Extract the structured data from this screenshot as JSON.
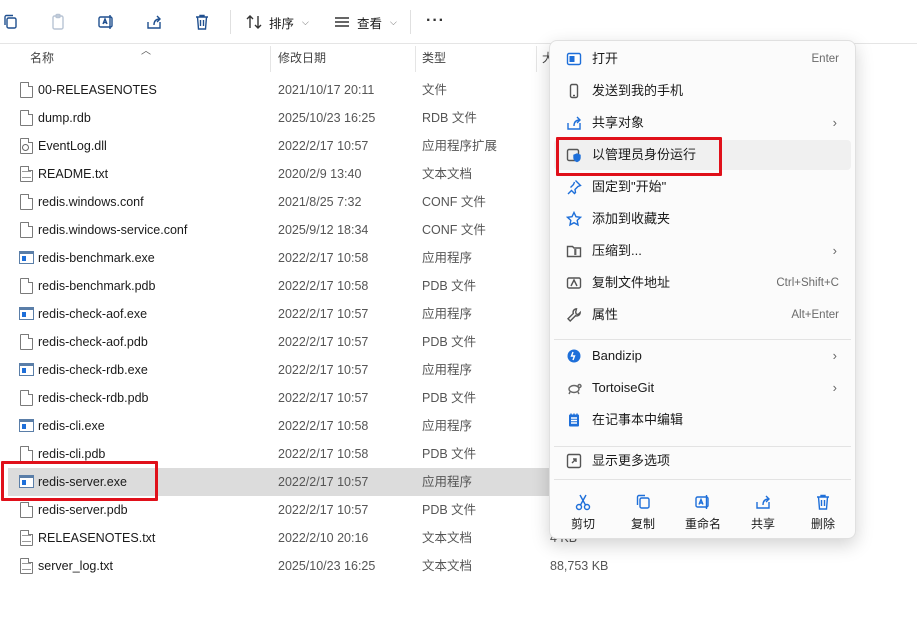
{
  "toolbar": {
    "sort_label": "排序",
    "view_label": "查看",
    "more_label": "···"
  },
  "columns": {
    "name": "名称",
    "date": "修改日期",
    "type": "类型",
    "size": "大"
  },
  "files": [
    {
      "name": "00-RELEASENOTES",
      "date": "2021/10/17 20:11",
      "type": "文件",
      "size": "",
      "icon": "file-icon"
    },
    {
      "name": "dump.rdb",
      "date": "2025/10/23 16:25",
      "type": "RDB 文件",
      "size": "",
      "icon": "file-icon"
    },
    {
      "name": "EventLog.dll",
      "date": "2022/2/17 10:57",
      "type": "应用程序扩展",
      "size": "",
      "icon": "dll-icon"
    },
    {
      "name": "README.txt",
      "date": "2020/2/9 13:40",
      "type": "文本文档",
      "size": "",
      "icon": "text-file-icon"
    },
    {
      "name": "redis.windows.conf",
      "date": "2021/8/25 7:32",
      "type": "CONF 文件",
      "size": "",
      "icon": "file-icon"
    },
    {
      "name": "redis.windows-service.conf",
      "date": "2025/9/12 18:34",
      "type": "CONF 文件",
      "size": "",
      "icon": "file-icon"
    },
    {
      "name": "redis-benchmark.exe",
      "date": "2022/2/17 10:58",
      "type": "应用程序",
      "size": "",
      "icon": "exe-icon"
    },
    {
      "name": "redis-benchmark.pdb",
      "date": "2022/2/17 10:58",
      "type": "PDB 文件",
      "size": "",
      "icon": "file-icon"
    },
    {
      "name": "redis-check-aof.exe",
      "date": "2022/2/17 10:57",
      "type": "应用程序",
      "size": "",
      "icon": "exe-icon"
    },
    {
      "name": "redis-check-aof.pdb",
      "date": "2022/2/17 10:57",
      "type": "PDB 文件",
      "size": "",
      "icon": "file-icon"
    },
    {
      "name": "redis-check-rdb.exe",
      "date": "2022/2/17 10:57",
      "type": "应用程序",
      "size": "",
      "icon": "exe-icon"
    },
    {
      "name": "redis-check-rdb.pdb",
      "date": "2022/2/17 10:57",
      "type": "PDB 文件",
      "size": "",
      "icon": "file-icon"
    },
    {
      "name": "redis-cli.exe",
      "date": "2022/2/17 10:58",
      "type": "应用程序",
      "size": "",
      "icon": "exe-icon"
    },
    {
      "name": "redis-cli.pdb",
      "date": "2022/2/17 10:58",
      "type": "PDB 文件",
      "size": "",
      "icon": "file-icon"
    },
    {
      "name": "redis-server.exe",
      "date": "2022/2/17 10:57",
      "type": "应用程序",
      "size": "",
      "icon": "exe-icon",
      "selected": true
    },
    {
      "name": "redis-server.pdb",
      "date": "2022/2/17 10:57",
      "type": "PDB 文件",
      "size": "",
      "icon": "file-icon"
    },
    {
      "name": "RELEASENOTES.txt",
      "date": "2022/2/10 20:16",
      "type": "文本文档",
      "size": "4 KB",
      "icon": "text-file-icon"
    },
    {
      "name": "server_log.txt",
      "date": "2025/10/23 16:25",
      "type": "文本文档",
      "size": "88,753 KB",
      "icon": "text-file-icon"
    }
  ],
  "context_menu": {
    "items": [
      {
        "label": "打开",
        "shortcut": "Enter",
        "icon": "open-app-icon"
      },
      {
        "label": "发送到我的手机",
        "shortcut": "",
        "icon": "phone-icon"
      },
      {
        "label": "共享对象",
        "shortcut": "",
        "icon": "share-icon",
        "submenu": true
      },
      {
        "label": "以管理员身份运行",
        "shortcut": "",
        "icon": "admin-shield-icon",
        "highlighted": true
      },
      {
        "label": "固定到\"开始\"",
        "shortcut": "",
        "icon": "pin-icon"
      },
      {
        "label": "添加到收藏夹",
        "shortcut": "",
        "icon": "star-icon"
      },
      {
        "label": "压缩到...",
        "shortcut": "",
        "icon": "zip-folder-icon",
        "submenu": true
      },
      {
        "label": "复制文件地址",
        "shortcut": "Ctrl+Shift+C",
        "icon": "copy-path-icon"
      },
      {
        "label": "属性",
        "shortcut": "Alt+Enter",
        "icon": "wrench-icon"
      },
      {
        "label": "Bandizip",
        "shortcut": "",
        "icon": "bandizip-icon",
        "submenu": true
      },
      {
        "label": "TortoiseGit",
        "shortcut": "",
        "icon": "tortoisegit-icon",
        "submenu": true
      },
      {
        "label": "在记事本中编辑",
        "shortcut": "",
        "icon": "notepad-icon"
      },
      {
        "label": "显示更多选项",
        "shortcut": "",
        "icon": "more-options-icon"
      }
    ],
    "quick_actions": [
      {
        "label": "剪切",
        "icon": "cut-icon"
      },
      {
        "label": "复制",
        "icon": "copy-icon"
      },
      {
        "label": "重命名",
        "icon": "rename-icon"
      },
      {
        "label": "共享",
        "icon": "share-icon"
      },
      {
        "label": "删除",
        "icon": "delete-icon"
      }
    ]
  },
  "colors": {
    "accent": "#1e6fd9",
    "highlight_box": "#e0101a",
    "selected_row": "#dcdcdc"
  }
}
